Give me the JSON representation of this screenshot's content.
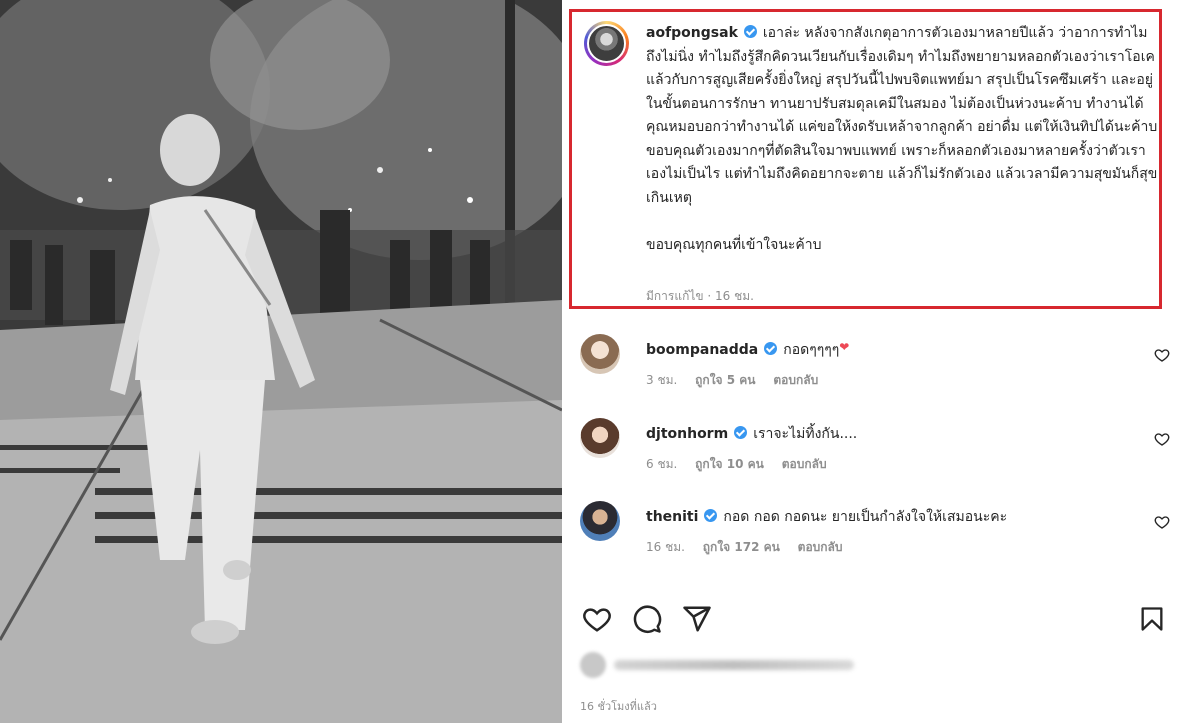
{
  "post": {
    "author": {
      "username": "aofpongsak",
      "verified": true
    },
    "caption": "เอาล่ะ หลังจากสังเกตุอาการตัวเองมาหลายปีแล้ว ว่าอาการทำไมถึงไม่นิ่ง ทำไมถึงรู้สึกคิดวนเวียนกับเรื่องเดิมๆ ทำไมถึงพยายามหลอกตัวเองว่าเราโอเคแล้วกับการสูญเสียครั้งยิ่งใหญ่ สรุปวันนี้ไปพบจิตแพทย์มา สรุปเป็นโรคซึมเศร้า และอยู่ในขั้นตอนการรักษา ทานยาปรับสมดุลเคมีในสมอง ไม่ต้องเป็นห่วงนะค้าบ ทำงานได้ คุณหมอบอกว่าทำงานได้ แค่ขอให้งดรับเหล้าจากลูกค้า อย่าดื่ม แต่ให้เงินทิปได้นะค้าบ ขอบคุณตัวเองมากๆที่ตัดสินใจมาพบแพทย์ เพราะก็หลอกตัวเองมาหลายครั้งว่าตัวเราเองไม่เป็นไร แต่ทำไมถึงคิดอยากจะตาย แล้วก็ไม่รักตัวเอง แล้วเวลามีความสุขมันก็สุขเกินเหตุ\n\nขอบคุณทุกคนที่เข้าใจนะค้าบ",
    "meta": "มีการแก้ไข · 16 ชม.",
    "time_ago": "16 ชั่วโมงที่แล้ว"
  },
  "comments": [
    {
      "username": "boompanadda",
      "verified": true,
      "text": "กอดๆๆๆๆ",
      "emoji": "❤",
      "time": "3 ชม.",
      "likes": "ถูกใจ 5 คน",
      "reply": "ตอบกลับ"
    },
    {
      "username": "djtonhorm",
      "verified": true,
      "text": "เราจะไม่ทิ้งกัน....",
      "time": "6 ชม.",
      "likes": "ถูกใจ 10 คน",
      "reply": "ตอบกลับ"
    },
    {
      "username": "theniti",
      "verified": true,
      "text": "กอด กอด กอดนะ ยายเป็นกำลังใจให้เสมอนะคะ",
      "time": "16 ชม.",
      "likes": "ถูกใจ 172 คน",
      "reply": "ตอบกลับ"
    }
  ],
  "icons": {
    "like": "heart-icon",
    "comment": "comment-bubble-icon",
    "share": "paper-plane-icon",
    "save": "bookmark-icon",
    "verified": "verified-badge-icon"
  },
  "colors": {
    "highlight_border": "#d7282f",
    "verified": "#3897f0",
    "heart_emoji": "#ed4956"
  }
}
